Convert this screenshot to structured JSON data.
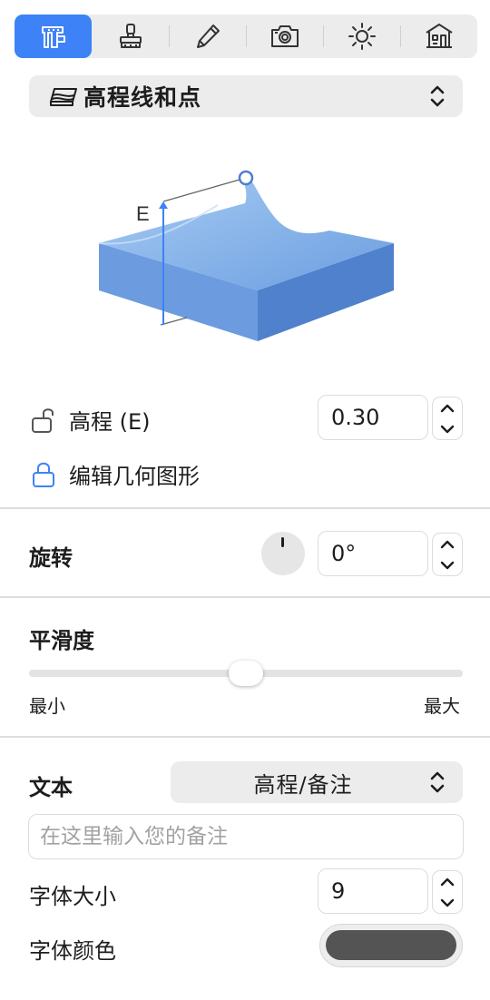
{
  "toolbar": {
    "tools": [
      {
        "name": "measure-tool",
        "active": true
      },
      {
        "name": "stamp-tool",
        "active": false
      },
      {
        "name": "pencil-tool",
        "active": false
      },
      {
        "name": "camera-tool",
        "active": false
      },
      {
        "name": "sun-tool",
        "active": false
      },
      {
        "name": "building-tool",
        "active": false
      }
    ]
  },
  "mode_dropdown": {
    "label": "高程线和点",
    "icon": "terrain-layers-icon"
  },
  "illustration": {
    "axis_label": "E"
  },
  "elevation": {
    "label": "高程 (E)",
    "value": "0.30",
    "lock_icon": "unlocked-padlock-icon"
  },
  "edit_geometry": {
    "label": "编辑几何图形",
    "lock_icon": "padlock-icon"
  },
  "rotation": {
    "label": "旋转",
    "value": "0°"
  },
  "smoothness": {
    "label": "平滑度",
    "min_label": "最小",
    "max_label": "最大",
    "level": 0.5
  },
  "text": {
    "label": "文本",
    "selected": "高程/备注",
    "note_placeholder": "在这里输入您的备注"
  },
  "font_size": {
    "label": "字体大小",
    "value": "9"
  },
  "font_color": {
    "label": "字体颜色",
    "color": "#545454"
  },
  "colors": {
    "accent": "#3d82f6",
    "terrain": "#5b8fd8"
  }
}
